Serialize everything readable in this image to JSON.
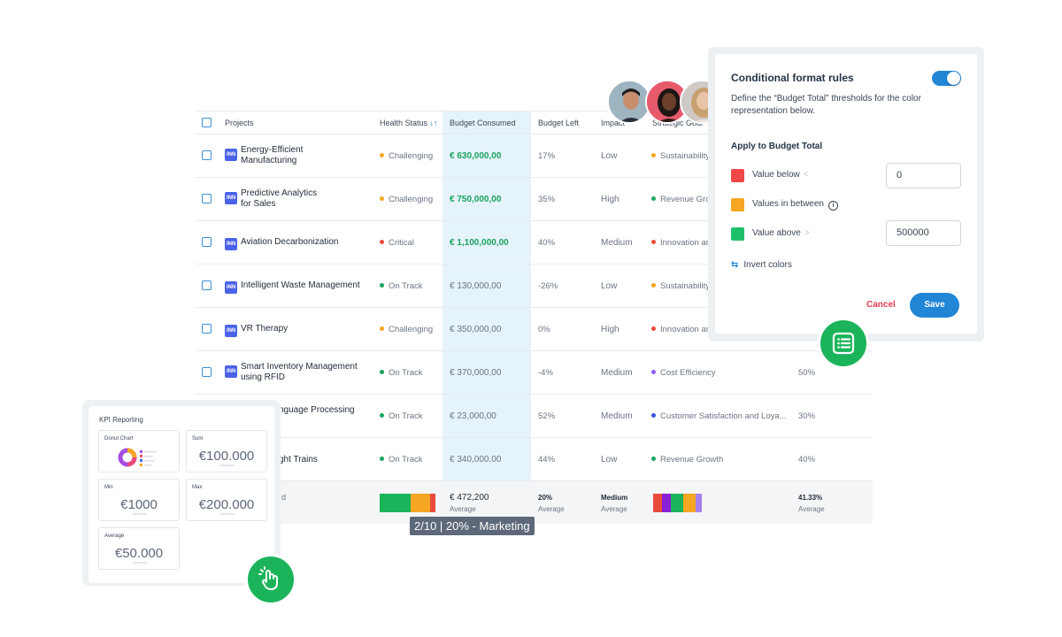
{
  "table": {
    "headers": {
      "projects": "Projects",
      "health_status": "Health Status",
      "sort_icon": "↓↑",
      "budget_consumed": "Budget Consumed",
      "budget_left": "Budget Left",
      "impact": "Impact",
      "strategic_goal": "Strategic Goal"
    },
    "tag_label": "INN",
    "rows": [
      {
        "name_line1": "Energy-Efficient",
        "name_line2": "Manufacturing",
        "health": "Challenging",
        "health_color": "#f5a623",
        "budget": "€ 630,000,00",
        "budget_highlight": true,
        "left": "17%",
        "impact": "Low",
        "goal": "Sustainability",
        "goal_color": "#f5a623",
        "pct": ""
      },
      {
        "name_line1": "Predictive Analytics",
        "name_line2": "for Sales",
        "health": "Challenging",
        "health_color": "#f5a623",
        "budget": "€ 750,000,00",
        "budget_highlight": true,
        "left": "35%",
        "impact": "High",
        "goal": "Revenue Grow",
        "goal_color": "#1aa35f",
        "pct": ""
      },
      {
        "name_line1": "Aviation Decarbonization",
        "name_line2": "",
        "health": "Critical",
        "health_color": "#e84a3c",
        "budget": "€ 1,100,000,00",
        "budget_highlight": true,
        "left": "40%",
        "impact": "Medium",
        "goal": "Innovation ar",
        "goal_color": "#e84a3c",
        "pct": ""
      },
      {
        "name_line1": "Intelligent Waste Management",
        "name_line2": "",
        "health": "On Track",
        "health_color": "#1aa35f",
        "budget": "€ 130,000,00",
        "budget_highlight": false,
        "left": "-26%",
        "impact": "Low",
        "goal": "Sustainability",
        "goal_color": "#f5a623",
        "pct": ""
      },
      {
        "name_line1": "VR Therapy",
        "name_line2": "",
        "health": "Challenging",
        "health_color": "#f5a623",
        "budget": "€ 350,000,00",
        "budget_highlight": false,
        "left": "0%",
        "impact": "High",
        "goal": "Innovation ar",
        "goal_color": "#e84a3c",
        "pct": ""
      },
      {
        "name_line1": "Smart Inventory Management",
        "name_line2": "using RFID",
        "health": "On Track",
        "health_color": "#1aa35f",
        "budget": "€ 370,000,00",
        "budget_highlight": false,
        "left": "-4%",
        "impact": "Medium",
        "goal": "Cost Efficiency",
        "goal_color": "#8a5cf5",
        "pct": "50%"
      },
      {
        "name_line1": "nguage Processing",
        "name_line2": "",
        "health": "On Track",
        "health_color": "#1aa35f",
        "budget": "€ 23,000,00",
        "budget_highlight": false,
        "left": "52%",
        "impact": "Medium",
        "goal": "Customer Satisfaction and Loya...",
        "goal_color": "#3b4fd8",
        "pct": "30%"
      },
      {
        "name_line1": "ght Trains",
        "name_line2": "",
        "health": "On Track",
        "health_color": "#1aa35f",
        "budget": "€ 340,000,00",
        "budget_highlight": false,
        "left": "44%",
        "impact": "Low",
        "goal": "Revenue Growth",
        "goal_color": "#1aa35f",
        "pct": "40%"
      }
    ],
    "summary": {
      "label": "d",
      "budget": "€ 472,200",
      "budget_sub": "Average",
      "left": "20%",
      "left_sub": "Average",
      "impact": "Medium",
      "impact_sub": "Average",
      "pct": "41.33%",
      "pct_sub": "Average",
      "health_bar": [
        {
          "color": "#1bb45a",
          "fraction": 0.55
        },
        {
          "color": "#f5a623",
          "fraction": 0.35
        },
        {
          "color": "#e84a3c",
          "fraction": 0.1
        }
      ],
      "goal_bar": [
        {
          "color": "#e84a3c",
          "fraction": 0.18
        },
        {
          "color": "#8a1fd6",
          "fraction": 0.18
        },
        {
          "color": "#1bb45a",
          "fraction": 0.26
        },
        {
          "color": "#f5a623",
          "fraction": 0.26
        },
        {
          "color": "#a582f0",
          "fraction": 0.12
        }
      ]
    }
  },
  "tooltip": "2/10 | 20% - Marketing",
  "conditional_format": {
    "title": "Conditional format rules",
    "toggle_on": true,
    "description": "Define the “Budget Total” thresholds for the color representation below.",
    "subtitle": "Apply to Budget Total",
    "rules": [
      {
        "label": "Value below",
        "arrow": "<",
        "color": "#f04747",
        "value": "0"
      },
      {
        "label": "Values in between",
        "arrow": "",
        "color": "#f5a623",
        "value": ""
      },
      {
        "label": "Value above",
        "arrow": ">",
        "color": "#1fc06b",
        "value": "500000"
      }
    ],
    "info_glyph": "i",
    "invert_icon": "⇆",
    "invert_label": "Invert colors",
    "cancel_label": "Cancel",
    "save_label": "Save"
  },
  "kpi": {
    "title": "KPI Reporting",
    "cards": [
      {
        "label": "Donut Chart",
        "value": ""
      },
      {
        "label": "Sum",
        "value": "€100.000"
      },
      {
        "label": "Min",
        "value": "€1000"
      },
      {
        "label": "Max",
        "value": "€200.000"
      },
      {
        "label": "Average",
        "value": "€50.000"
      }
    ]
  },
  "colors": {
    "accent": "#2286d6",
    "success": "#1bb45a",
    "danger": "#e53950",
    "highlight_column": "#e5f3fb"
  },
  "icons": [
    "list-icon",
    "hand-click-icon",
    "swap-icon",
    "info-icon",
    "sort-icon",
    "donut-chart-icon"
  ]
}
